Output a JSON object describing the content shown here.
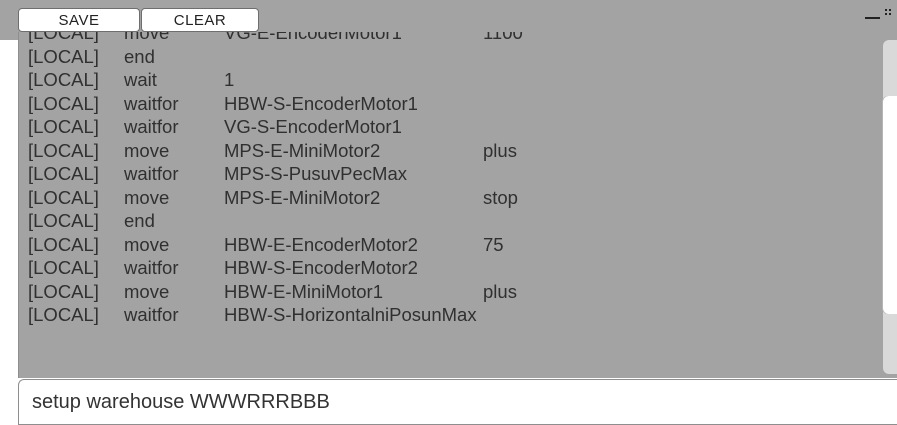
{
  "toolbar": {
    "save_label": "SAVE",
    "clear_label": "CLEAR"
  },
  "log": {
    "lines": [
      {
        "tag": "[LOCAL]",
        "cmd": "move",
        "arg": "VG-E-EncoderMotor1",
        "val": "1100"
      },
      {
        "tag": "[LOCAL]",
        "cmd": "end",
        "arg": "",
        "val": ""
      },
      {
        "tag": "[LOCAL]",
        "cmd": "wait",
        "arg": "1",
        "val": ""
      },
      {
        "tag": "[LOCAL]",
        "cmd": "waitfor",
        "arg": "HBW-S-EncoderMotor1",
        "val": ""
      },
      {
        "tag": "[LOCAL]",
        "cmd": "waitfor",
        "arg": "VG-S-EncoderMotor1",
        "val": ""
      },
      {
        "tag": "[LOCAL]",
        "cmd": "move",
        "arg": "MPS-E-MiniMotor2",
        "val": "plus"
      },
      {
        "tag": "[LOCAL]",
        "cmd": "waitfor",
        "arg": "MPS-S-PusuvPecMax",
        "val": ""
      },
      {
        "tag": "[LOCAL]",
        "cmd": "move",
        "arg": "MPS-E-MiniMotor2",
        "val": "stop"
      },
      {
        "tag": "[LOCAL]",
        "cmd": "end",
        "arg": "",
        "val": ""
      },
      {
        "tag": "[LOCAL]",
        "cmd": "move",
        "arg": "HBW-E-EncoderMotor2",
        "val": "75"
      },
      {
        "tag": "[LOCAL]",
        "cmd": "waitfor",
        "arg": "HBW-S-EncoderMotor2",
        "val": ""
      },
      {
        "tag": "[LOCAL]",
        "cmd": "move",
        "arg": "HBW-E-MiniMotor1",
        "val": "plus"
      },
      {
        "tag": "[LOCAL]",
        "cmd": "waitfor",
        "arg": "HBW-S-HorizontalniPosunMax",
        "val": ""
      }
    ]
  },
  "command": {
    "value": "setup warehouse WWWRRRBBB"
  },
  "colors": {
    "panel_bg": "#a3a3a3",
    "text": "#303030"
  }
}
